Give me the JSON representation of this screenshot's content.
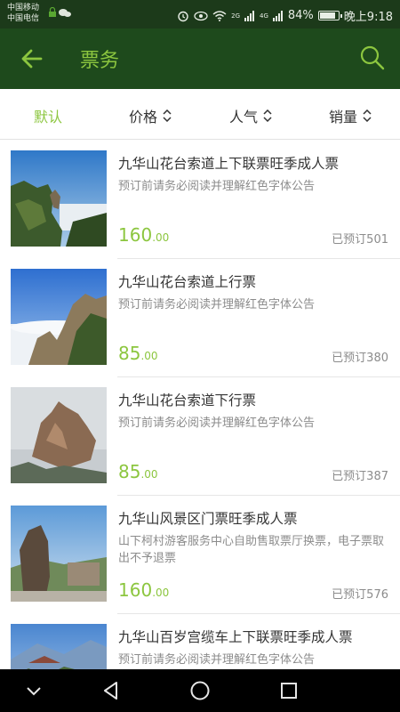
{
  "status_bar": {
    "carrier_1": "中国移动",
    "carrier_2": "中国电信",
    "battery_percent": "84%",
    "battery_level": 0.84,
    "time": "晚上9:18",
    "network_1": "2G",
    "network_2": "4G"
  },
  "app_bar": {
    "back_icon": "arrow-left-icon",
    "title": "票务",
    "search_icon": "search-icon"
  },
  "sort_bar": {
    "items": [
      {
        "label": "默认",
        "active": true
      },
      {
        "label": "价格",
        "active": false
      },
      {
        "label": "人气",
        "active": false
      },
      {
        "label": "销量",
        "active": false
      }
    ]
  },
  "tickets": [
    {
      "name": "九华山花台索道上下联票旺季成人票",
      "desc": "预订前请务必阅读并理解红色字体公告",
      "price_int": "160",
      "price_dec": ".00",
      "sold": "已预订501"
    },
    {
      "name": "九华山花台索道上行票",
      "desc": "预订前请务必阅读并理解红色字体公告",
      "price_int": "85",
      "price_dec": ".00",
      "sold": "已预订380"
    },
    {
      "name": "九华山花台索道下行票",
      "desc": "预订前请务必阅读并理解红色字体公告",
      "price_int": "85",
      "price_dec": ".00",
      "sold": "已预订387"
    },
    {
      "name": "九华山风景区门票旺季成人票",
      "desc": "山下柯村游客服务中心自助售取票厅换票，电子票取出不予退票",
      "price_int": "160",
      "price_dec": ".00",
      "sold": "已预订576"
    },
    {
      "name": "九华山百岁宫缆车上下联票旺季成人票",
      "desc": "预订前请务必阅读并理解红色字体公告",
      "price_int": "",
      "price_dec": "",
      "sold": ""
    }
  ],
  "colors": {
    "accent": "#8cc63f",
    "app_bar": "#1e4a1c",
    "status_bar": "#1c3a1a"
  },
  "nav_bar": {
    "icons": [
      "chevron-down-icon",
      "back-triangle-icon",
      "home-circle-icon",
      "recents-square-icon"
    ]
  }
}
